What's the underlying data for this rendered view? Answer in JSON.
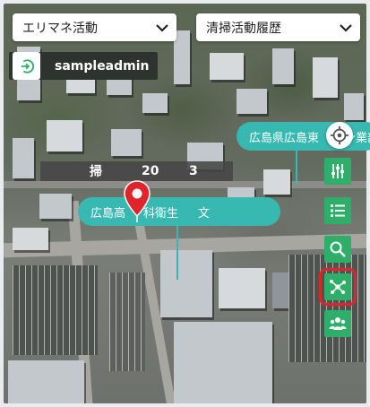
{
  "filters": {
    "area_select": {
      "value": "エリマネ活動",
      "icon": "chevron-down-icon"
    },
    "history_select": {
      "value": "清掃活動履歴",
      "icon": "chevron-down-icon"
    }
  },
  "user": {
    "name": "sampleadmin",
    "icon": "logout-icon"
  },
  "map": {
    "labels": [
      {
        "text": "広島県広島東",
        "suffix": "ン業部"
      },
      {
        "text": "広島高",
        "middle": "科衛生",
        "end": "文"
      }
    ],
    "info_bar": {
      "col1": "掃",
      "col2": "20",
      "col3": "3"
    }
  },
  "toolbar": {
    "buttons": [
      {
        "name": "layers-button",
        "icon": "sliders-icon"
      },
      {
        "name": "list-button",
        "icon": "list-icon"
      },
      {
        "name": "search-button",
        "icon": "search-icon"
      },
      {
        "name": "network-button",
        "icon": "network-icon",
        "selected": true
      },
      {
        "name": "users-button",
        "icon": "users-icon"
      }
    ],
    "locate": {
      "icon": "crosshair-icon"
    }
  },
  "colors": {
    "accent_green": "#2fae69",
    "label_teal": "#37b8b0",
    "selection_red": "#e0242c",
    "pin_red": "#e0242c"
  }
}
